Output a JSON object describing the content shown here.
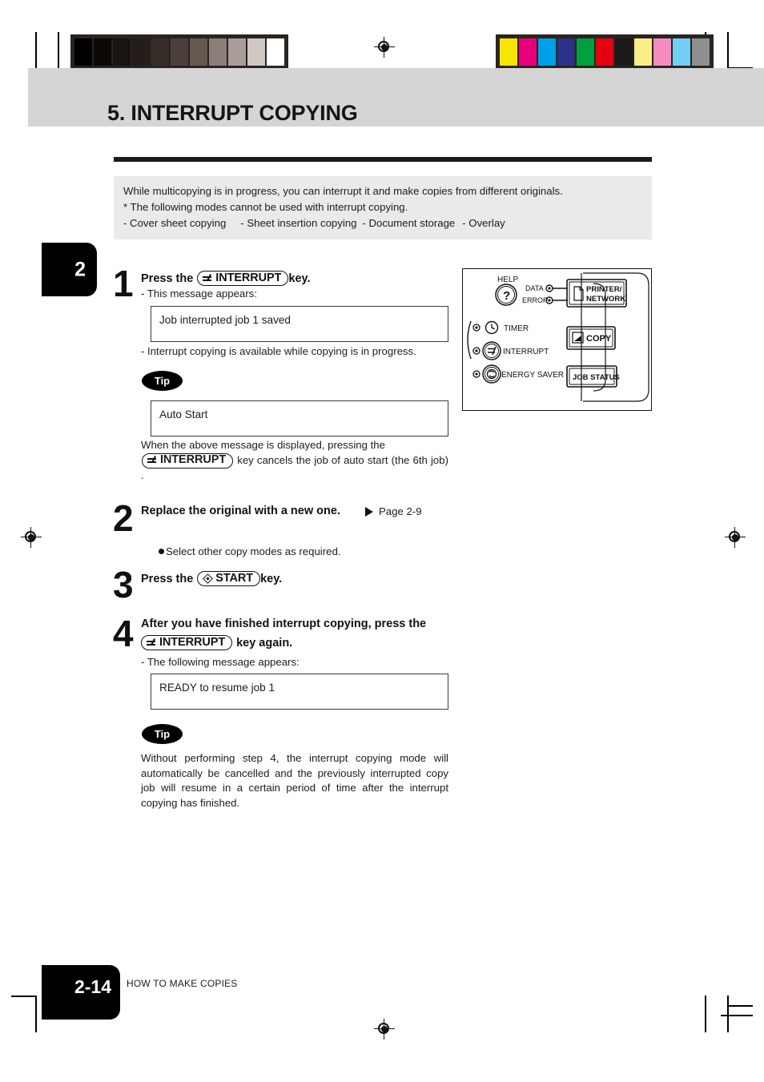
{
  "page": {
    "chapter_tab": "2",
    "footer_page_number": "2-14",
    "footer_section": "HOW TO MAKE COPIES"
  },
  "header": {
    "title": "5. INTERRUPT COPYING"
  },
  "intro": {
    "line1": "While multicopying is in progress, you can interrupt it and make copies from different originals.",
    "line2": "* The following modes cannot be used with interrupt copying.",
    "mode1": "- Cover sheet copying",
    "mode2": "- Sheet insertion copying",
    "mode3": "- Document storage",
    "mode4": "- Overlay"
  },
  "steps": [
    {
      "number": "1",
      "title_before": "Press the",
      "key_label": "INTERRUPT",
      "key_glyph": "interrupt-key-icon",
      "title_after": "key.",
      "sub1": "- This message appears:",
      "message1": "Job interrupted job 1 saved",
      "sub2": "- Interrupt copying is available while copying is in progress.",
      "tip_badge": "Tip",
      "message2": "Auto Start",
      "tip_text_part1": "When the above message is displayed, pressing  the",
      "tip_key_label": "INTERRUPT",
      "tip_text_part2": "key cancels the  job of auto start (the 6th job) ."
    },
    {
      "number": "2",
      "title": "Replace the original with a new one.",
      "page_ref": "Page 2-9",
      "bullet": "Select other copy modes as required."
    },
    {
      "number": "3",
      "title_before": "Press the",
      "key_label": "START",
      "key_glyph": "start-key-icon",
      "title_after": "key."
    },
    {
      "number": "4",
      "title_line1": "After you have finished interrupt copying, press the",
      "key_label": "INTERRUPT",
      "title_line2": "key again.",
      "sub1": "- The following message appears:",
      "message1": "READY to resume job 1",
      "tip_badge": "Tip",
      "tip_text": "Without performing step 4, the interrupt copying mode will automatically be cancelled and the previously interrupted copy job will resume in a certain period of time after the interrupt copying has finished."
    }
  ],
  "control_panel": {
    "help_label": "HELP",
    "help_glyph": "?",
    "data_label": "DATA",
    "error_label": "ERROR",
    "printer_network_label_line1": "PRINTER/",
    "printer_network_label_line2": "NETWORK",
    "timer_label": "TIMER",
    "interrupt_label": "INTERRUPT",
    "energy_saver_label": "ENERGY SAVER",
    "copy_label": "COPY",
    "job_status_label": "JOB STATUS"
  },
  "print_marks": {
    "grayscale_wedge": [
      "#000000",
      "#0c0806",
      "#1a1411",
      "#241d19",
      "#372d28",
      "#4a3f3a",
      "#655952",
      "#8b7f79",
      "#a89d98",
      "#d2c8c3",
      "#ffffff"
    ],
    "color_bar": [
      "#f6e500",
      "#e6007e",
      "#00a0e9",
      "#2b3188",
      "#00a040",
      "#e60012",
      "#1a1a1a",
      "#faed8a",
      "#f48cc0",
      "#73cef4",
      "#8f8f8f"
    ]
  }
}
